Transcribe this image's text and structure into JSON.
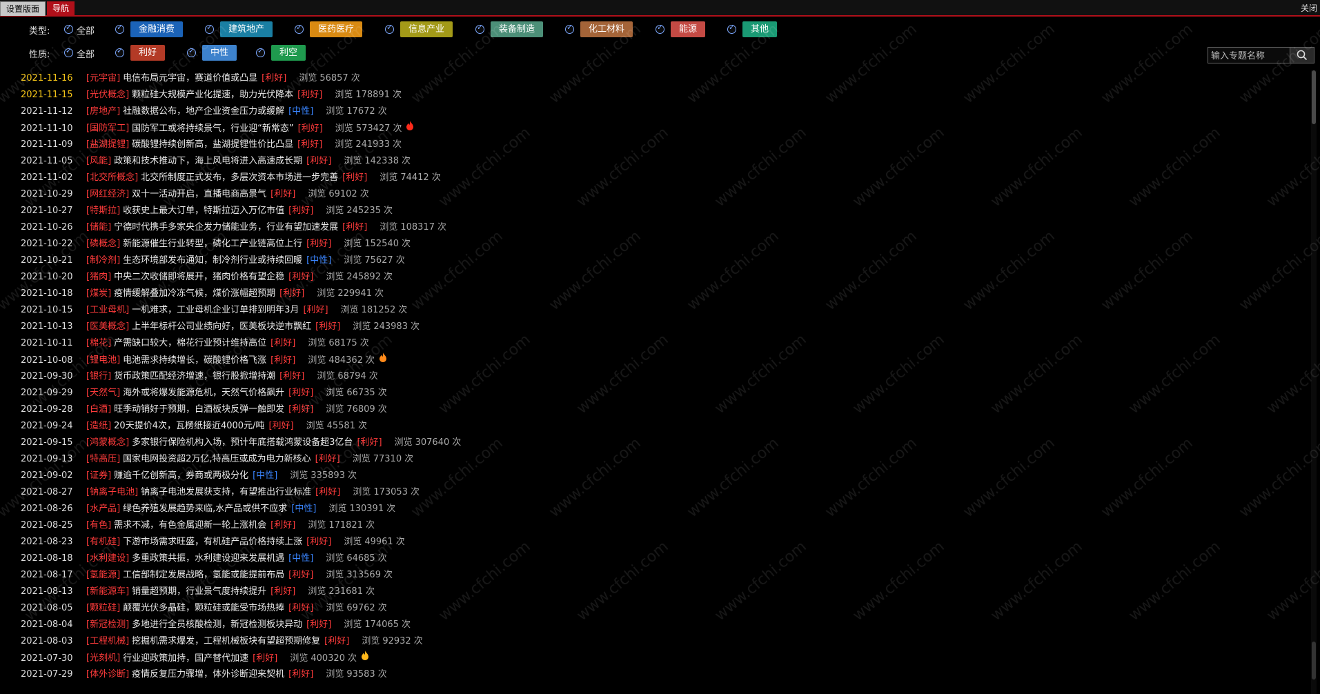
{
  "tabs": {
    "settings": "设置版面",
    "nav": "导航",
    "close": "关闭"
  },
  "type_filter": {
    "label": "类型:",
    "all": "全部",
    "tags": [
      {
        "label": "金融消费",
        "bg": "#1b63b8",
        "fg": "#ffffff"
      },
      {
        "label": "建筑地产",
        "bg": "#1a7fa3",
        "fg": "#ffffff"
      },
      {
        "label": "医药医疗",
        "bg": "#d98a12",
        "fg": "#ffffff"
      },
      {
        "label": "信息产业",
        "bg": "#a39a18",
        "fg": "#ffffff"
      },
      {
        "label": "装备制造",
        "bg": "#4c8f78",
        "fg": "#ffffff"
      },
      {
        "label": "化工材料",
        "bg": "#a46438",
        "fg": "#ffffff"
      },
      {
        "label": "能源",
        "bg": "#c44a44",
        "fg": "#ffffff"
      },
      {
        "label": "其他",
        "bg": "#1a9a74",
        "fg": "#ffffff"
      }
    ]
  },
  "nature_filter": {
    "label": "性质:",
    "all": "全部",
    "tags": [
      {
        "label": "利好",
        "bg": "#b33a26",
        "fg": "#ffffff"
      },
      {
        "label": "中性",
        "bg": "#3d82cc",
        "fg": "#ffffff"
      },
      {
        "label": "利空",
        "bg": "#1f9a4e",
        "fg": "#ffffff"
      }
    ]
  },
  "search": {
    "placeholder": "输入专题名称"
  },
  "views_label": "浏览",
  "views_unit": "次",
  "watermark": "www.cfchi.com",
  "rows": [
    {
      "date": "2021-11-16",
      "recent": true,
      "category": "[元宇宙]",
      "title": "电信布局元宇宙，赛道价值或凸显",
      "tag": "[利好]",
      "tag_type": "good",
      "views": "56857",
      "hot": false
    },
    {
      "date": "2021-11-15",
      "recent": true,
      "category": "[光伏概念]",
      "title": "颗粒硅大规模产业化提速，助力光伏降本",
      "tag": "[利好]",
      "tag_type": "good",
      "views": "178891",
      "hot": false
    },
    {
      "date": "2021-11-12",
      "recent": false,
      "category": "[房地产]",
      "title": "社融数据公布，地产企业资金压力或缓解",
      "tag": "[中性]",
      "tag_type": "neutral",
      "views": "17672",
      "hot": false
    },
    {
      "date": "2021-11-10",
      "recent": false,
      "category": "[国防军工]",
      "title": "国防军工或将持续景气，行业迎“新常态”",
      "tag": "[利好]",
      "tag_type": "good",
      "views": "573427",
      "hot": true,
      "hot_color": "#ff2a1a"
    },
    {
      "date": "2021-11-09",
      "recent": false,
      "category": "[盐湖提锂]",
      "title": "碳酸锂持续创新高，盐湖提锂性价比凸显",
      "tag": "[利好]",
      "tag_type": "good",
      "views": "241933",
      "hot": false
    },
    {
      "date": "2021-11-05",
      "recent": false,
      "category": "[风能]",
      "title": "政策和技术推动下，海上风电将进入高速成长期",
      "tag": "[利好]",
      "tag_type": "good",
      "views": "142338",
      "hot": false
    },
    {
      "date": "2021-11-02",
      "recent": false,
      "category": "[北交所概念]",
      "title": "北交所制度正式发布，多层次资本市场进一步完善",
      "tag": "[利好]",
      "tag_type": "good",
      "views": "74412",
      "hot": false
    },
    {
      "date": "2021-10-29",
      "recent": false,
      "category": "[网红经济]",
      "title": "双十一活动开启，直播电商高景气",
      "tag": "[利好]",
      "tag_type": "good",
      "views": "69102",
      "hot": false
    },
    {
      "date": "2021-10-27",
      "recent": false,
      "category": "[特斯拉]",
      "title": "收获史上最大订单，特斯拉迈入万亿市值",
      "tag": "[利好]",
      "tag_type": "good",
      "views": "245235",
      "hot": false
    },
    {
      "date": "2021-10-26",
      "recent": false,
      "category": "[储能]",
      "title": "宁德时代携手多家央企发力储能业务，行业有望加速发展",
      "tag": "[利好]",
      "tag_type": "good",
      "views": "108317",
      "hot": false
    },
    {
      "date": "2021-10-22",
      "recent": false,
      "category": "[磷概念]",
      "title": "新能源催生行业转型，磷化工产业链高位上行",
      "tag": "[利好]",
      "tag_type": "good",
      "views": "152540",
      "hot": false
    },
    {
      "date": "2021-10-21",
      "recent": false,
      "category": "[制冷剂]",
      "title": "生态环境部发布通知，制冷剂行业或持续回暖",
      "tag": "[中性]",
      "tag_type": "neutral",
      "views": "75627",
      "hot": false
    },
    {
      "date": "2021-10-20",
      "recent": false,
      "category": "[猪肉]",
      "title": "中央二次收储即将展开，猪肉价格有望企稳",
      "tag": "[利好]",
      "tag_type": "good",
      "views": "245892",
      "hot": false
    },
    {
      "date": "2021-10-18",
      "recent": false,
      "category": "[煤炭]",
      "title": "疫情缓解叠加冷冻气候，煤价涨幅超预期",
      "tag": "[利好]",
      "tag_type": "good",
      "views": "229941",
      "hot": false
    },
    {
      "date": "2021-10-15",
      "recent": false,
      "category": "[工业母机]",
      "title": "一机难求，工业母机企业订单排到明年3月",
      "tag": "[利好]",
      "tag_type": "good",
      "views": "181252",
      "hot": false
    },
    {
      "date": "2021-10-13",
      "recent": false,
      "category": "[医美概念]",
      "title": "上半年标杆公司业绩向好，医美板块逆市飘红",
      "tag": "[利好]",
      "tag_type": "good",
      "views": "243983",
      "hot": false
    },
    {
      "date": "2021-10-11",
      "recent": false,
      "category": "[棉花]",
      "title": "产需缺口较大，棉花行业预计维持高位",
      "tag": "[利好]",
      "tag_type": "good",
      "views": "68175",
      "hot": false
    },
    {
      "date": "2021-10-08",
      "recent": false,
      "category": "[锂电池]",
      "title": "电池需求持续增长，碳酸锂价格飞涨",
      "tag": "[利好]",
      "tag_type": "good",
      "views": "484362",
      "hot": true,
      "hot_color": "#ff8a1a"
    },
    {
      "date": "2021-09-30",
      "recent": false,
      "category": "[银行]",
      "title": "货币政策匹配经济增速，银行股掀增持潮",
      "tag": "[利好]",
      "tag_type": "good",
      "views": "68794",
      "hot": false
    },
    {
      "date": "2021-09-29",
      "recent": false,
      "category": "[天然气]",
      "title": "海外或将爆发能源危机，天然气价格飙升",
      "tag": "[利好]",
      "tag_type": "good",
      "views": "66735",
      "hot": false
    },
    {
      "date": "2021-09-28",
      "recent": false,
      "category": "[白酒]",
      "title": "旺季动销好于预期，白酒板块反弹一触即发",
      "tag": "[利好]",
      "tag_type": "good",
      "views": "76809",
      "hot": false
    },
    {
      "date": "2021-09-24",
      "recent": false,
      "category": "[造纸]",
      "title": "20天提价4次，瓦楞纸接近4000元/吨",
      "tag": "[利好]",
      "tag_type": "good",
      "views": "45581",
      "hot": false
    },
    {
      "date": "2021-09-15",
      "recent": false,
      "category": "[鸿蒙概念]",
      "title": "多家银行保险机构入场，预计年底搭载鸿蒙设备超3亿台",
      "tag": "[利好]",
      "tag_type": "good",
      "views": "307640",
      "hot": false
    },
    {
      "date": "2021-09-13",
      "recent": false,
      "category": "[特高压]",
      "title": "国家电网投资超2万亿,特高压或成为电力新核心",
      "tag": "[利好]",
      "tag_type": "good",
      "views": "77310",
      "hot": false
    },
    {
      "date": "2021-09-02",
      "recent": false,
      "category": "[证券]",
      "title": "赚逾千亿创新高，券商或两极分化",
      "tag": "[中性]",
      "tag_type": "neutral",
      "views": "335893",
      "hot": false
    },
    {
      "date": "2021-08-27",
      "recent": false,
      "category": "[钠离子电池]",
      "title": "钠离子电池发展获支持，有望推出行业标准",
      "tag": "[利好]",
      "tag_type": "good",
      "views": "173053",
      "hot": false
    },
    {
      "date": "2021-08-26",
      "recent": false,
      "category": "[水产品]",
      "title": "绿色养殖发展趋势来临,水产品或供不应求",
      "tag": "[中性]",
      "tag_type": "neutral",
      "views": "130391",
      "hot": false
    },
    {
      "date": "2021-08-25",
      "recent": false,
      "category": "[有色]",
      "title": "需求不减，有色金属迎新一轮上涨机会",
      "tag": "[利好]",
      "tag_type": "good",
      "views": "171821",
      "hot": false
    },
    {
      "date": "2021-08-23",
      "recent": false,
      "category": "[有机硅]",
      "title": "下游市场需求旺盛，有机硅产品价格持续上涨",
      "tag": "[利好]",
      "tag_type": "good",
      "views": "49961",
      "hot": false
    },
    {
      "date": "2021-08-18",
      "recent": false,
      "category": "[水利建设]",
      "title": "多重政策共振，水利建设迎来发展机遇",
      "tag": "[中性]",
      "tag_type": "neutral",
      "views": "64685",
      "hot": false
    },
    {
      "date": "2021-08-17",
      "recent": false,
      "category": "[氢能源]",
      "title": "工信部制定发展战略，氢能或能提前布局",
      "tag": "[利好]",
      "tag_type": "good",
      "views": "313569",
      "hot": false
    },
    {
      "date": "2021-08-13",
      "recent": false,
      "category": "[新能源车]",
      "title": "销量超预期，行业景气度持续提升",
      "tag": "[利好]",
      "tag_type": "good",
      "views": "231681",
      "hot": false
    },
    {
      "date": "2021-08-05",
      "recent": false,
      "category": "[颗粒硅]",
      "title": "颠覆光伏多晶硅，颗粒硅或能受市场热捧",
      "tag": "[利好]",
      "tag_type": "good",
      "views": "69762",
      "hot": false
    },
    {
      "date": "2021-08-04",
      "recent": false,
      "category": "[新冠检测]",
      "title": "多地进行全员核酸检测，新冠检测板块异动",
      "tag": "[利好]",
      "tag_type": "good",
      "views": "174065",
      "hot": false
    },
    {
      "date": "2021-08-03",
      "recent": false,
      "category": "[工程机械]",
      "title": "挖掘机需求爆发，工程机械板块有望超预期修复",
      "tag": "[利好]",
      "tag_type": "good",
      "views": "92932",
      "hot": false
    },
    {
      "date": "2021-07-30",
      "recent": false,
      "category": "[光刻机]",
      "title": "行业迎政策加持，国产替代加速",
      "tag": "[利好]",
      "tag_type": "good",
      "views": "400320",
      "hot": true,
      "hot_color": "#ffb81a"
    },
    {
      "date": "2021-07-29",
      "recent": false,
      "category": "[体外诊断]",
      "title": "疫情反复压力骤增，体外诊断迎来契机",
      "tag": "[利好]",
      "tag_type": "good",
      "views": "93583",
      "hot": false
    }
  ]
}
